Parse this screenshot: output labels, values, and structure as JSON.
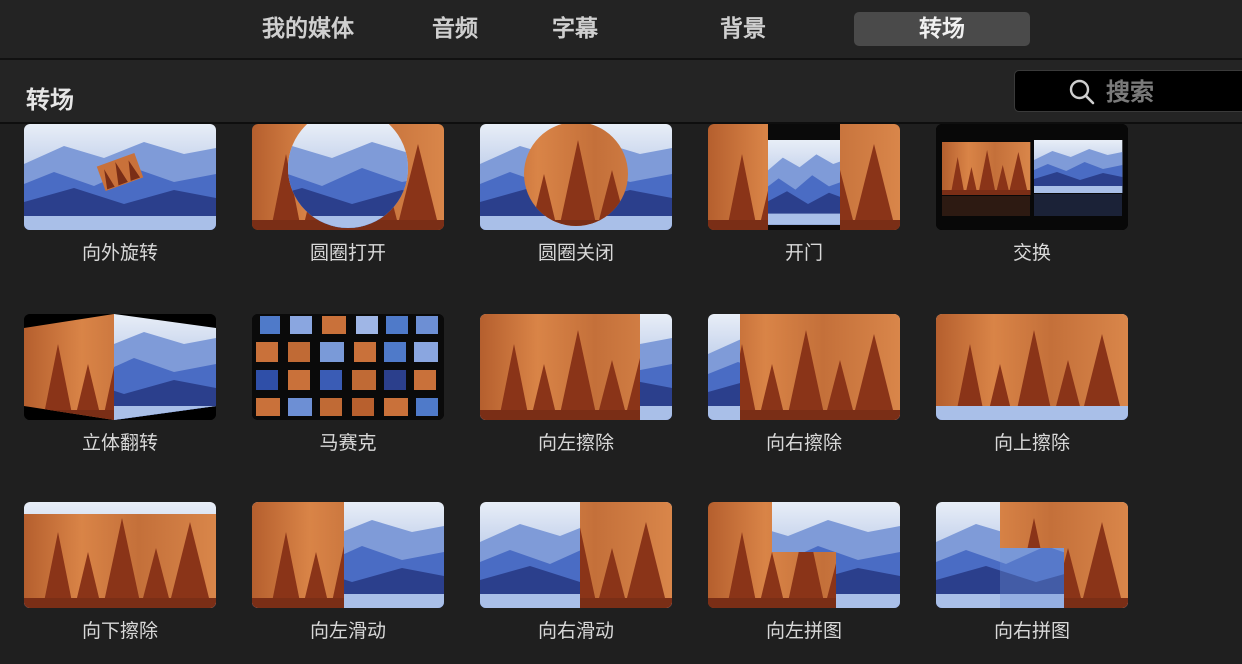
{
  "tabs": [
    {
      "label": "我的媒体",
      "active": false
    },
    {
      "label": "音频",
      "active": false
    },
    {
      "label": "字幕",
      "active": false
    },
    {
      "label": "背景",
      "active": false
    },
    {
      "label": "转场",
      "active": true
    }
  ],
  "header": {
    "title": "转场"
  },
  "search": {
    "placeholder": "搜索",
    "value": ""
  },
  "transitions": [
    {
      "label": "向外旋转"
    },
    {
      "label": "圆圈打开"
    },
    {
      "label": "圆圈关闭"
    },
    {
      "label": "开门"
    },
    {
      "label": "交换"
    },
    {
      "label": "立体翻转"
    },
    {
      "label": "马赛克"
    },
    {
      "label": "向左擦除"
    },
    {
      "label": "向右擦除"
    },
    {
      "label": "向上擦除"
    },
    {
      "label": "向下擦除"
    },
    {
      "label": "向左滑动"
    },
    {
      "label": "向右滑动"
    },
    {
      "label": "向左拼图"
    },
    {
      "label": "向右拼图"
    }
  ],
  "colors": {
    "background": "#1f1f1f",
    "tab_active": "#4a4a4a",
    "mountain_sky": "#a9bfe0",
    "mountain_dark": "#2b3f8c",
    "forest_orange": "#c9713a",
    "forest_dark": "#7a2e16"
  }
}
